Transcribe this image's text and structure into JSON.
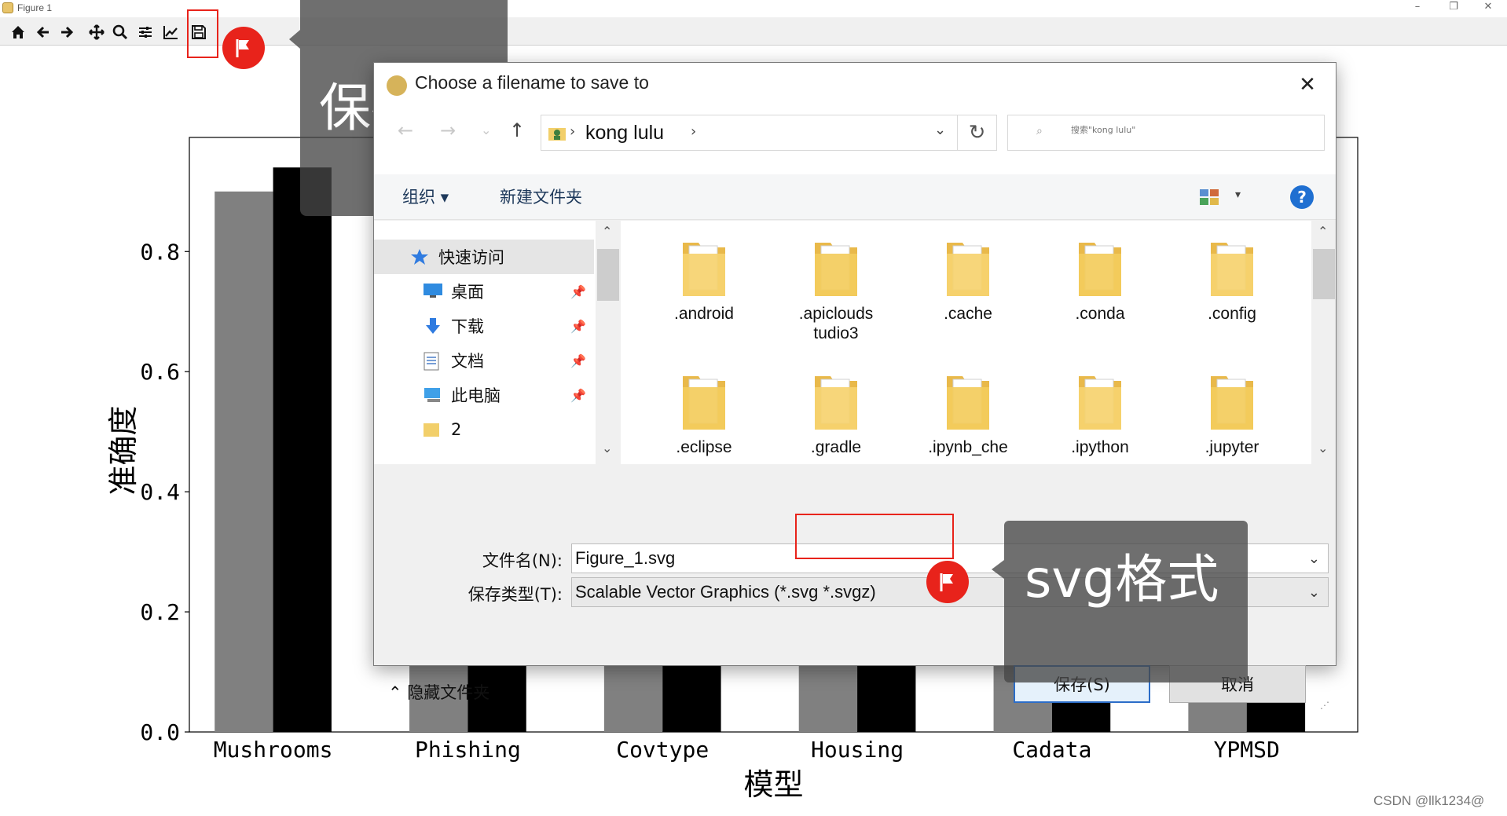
{
  "window": {
    "title": "Figure 1",
    "controls": [
      "–",
      "❐",
      "✕"
    ]
  },
  "toolbar": {
    "buttons": [
      "home-icon",
      "back-icon",
      "forward-icon",
      "pan-icon",
      "zoom-icon",
      "configure-icon",
      "edit-curves-icon",
      "save-icon"
    ]
  },
  "chart_data": {
    "type": "bar",
    "categories": [
      "Mushrooms",
      "Phishing",
      "Covtype",
      "Housing",
      "Cadata",
      "YPMSD"
    ],
    "series": [
      {
        "values": [
          0.9,
          0.9,
          0.9,
          0.9,
          0.9,
          0.9
        ],
        "color": "#808080"
      },
      {
        "values": [
          0.94,
          0.94,
          0.94,
          0.94,
          0.94,
          0.94
        ],
        "color": "#000000"
      }
    ],
    "xlabel": "模型",
    "ylabel": "准确度",
    "ylim": [
      0,
      0.99
    ],
    "yticks": [
      "0.0",
      "0.2",
      "0.4",
      "0.6",
      "0.8"
    ]
  },
  "dialog": {
    "title": "Choose a filename to save to",
    "close": "✕",
    "address": {
      "crumb": "kong lulu"
    },
    "search_placeholder": "搜索\"kong lulu\"",
    "commands": {
      "organize": "组织 ▾",
      "new_folder": "新建文件夹",
      "help": "?"
    },
    "nav_items": [
      {
        "label": "快速访问",
        "icon": "star-icon",
        "pinned": false
      },
      {
        "label": "桌面",
        "icon": "desktop-icon",
        "pinned": true
      },
      {
        "label": "下载",
        "icon": "download-icon",
        "pinned": true
      },
      {
        "label": "文档",
        "icon": "document-icon",
        "pinned": true
      },
      {
        "label": "此电脑",
        "icon": "computer-icon",
        "pinned": true
      },
      {
        "label": "2",
        "icon": "folder-icon",
        "pinned": false
      }
    ],
    "files": [
      ".android",
      ".apicloudstudio3",
      ".cache",
      ".conda",
      ".config",
      ".eclipse",
      ".gradle",
      ".ipynb_che",
      ".ipython",
      ".jupyter"
    ],
    "files_display": {
      "apicloud_line1": ".apiclouds",
      "apicloud_line2": "tudio3"
    },
    "filename_label": "文件名(N):",
    "filename_value": "Figure_1.svg",
    "filetype_label": "保存类型(T):",
    "filetype_value": "Scalable Vector Graphics (*.svg *.svgz)",
    "hide_folders": "隐藏文件夹",
    "save_button": "保存(S)",
    "cancel_button": "取消"
  },
  "annotations": {
    "save_callout": "保存",
    "format_callout": "svg格式"
  },
  "watermark": "CSDN @llk1234@"
}
